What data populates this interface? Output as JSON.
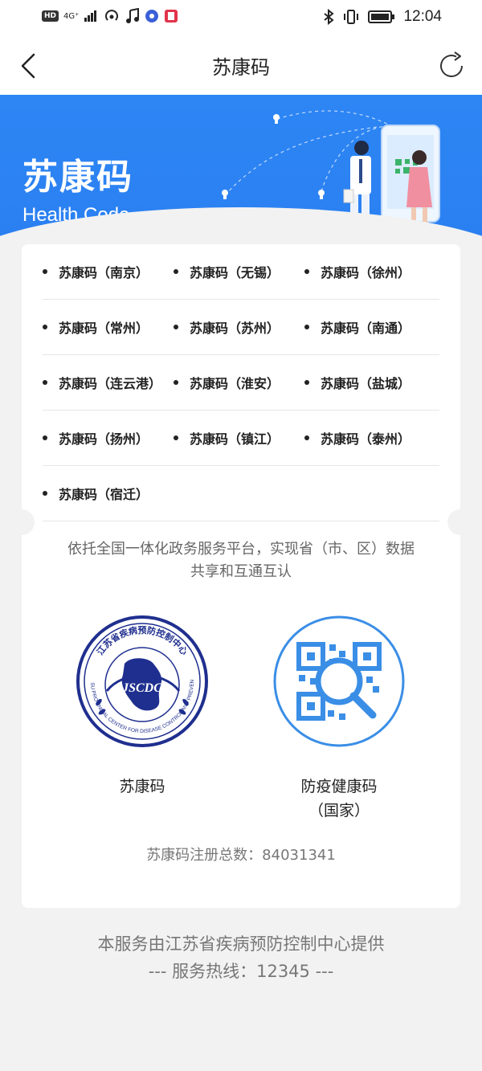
{
  "status_bar": {
    "network_badge": "HD",
    "network_type": "4G⁺",
    "time": "12:04"
  },
  "nav": {
    "title": "苏康码"
  },
  "hero": {
    "title": "苏康码",
    "subtitle": "Health Code"
  },
  "regions": [
    [
      "苏康码（南京）",
      "苏康码（无锡）",
      "苏康码（徐州）"
    ],
    [
      "苏康码（常州）",
      "苏康码（苏州）",
      "苏康码（南通）"
    ],
    [
      "苏康码（连云港）",
      "苏康码（淮安）",
      "苏康码（盐城）"
    ],
    [
      "苏康码（扬州）",
      "苏康码（镇江）",
      "苏康码（泰州）"
    ],
    [
      "苏康码（宿迁）"
    ]
  ],
  "intro": {
    "line1": "依托全国一体化政务服务平台，实现省（市、区）数据",
    "line2": "共享和互通互认"
  },
  "apps": {
    "su_kang_ma": {
      "name": "苏康码",
      "logo_text_top": "江苏省疾病预防控制中心",
      "logo_text_bottom": "JIANGSU PROVINCIAL CENTER FOR DISEASE CONTROL AND PREVENTION",
      "logo_mono": "JSCDC"
    },
    "national": {
      "name_line1": "防疫健康码",
      "name_line2": "（国家）"
    }
  },
  "registration": {
    "text": "苏康码注册总数：84031341"
  },
  "footer": {
    "line1": "本服务由江苏省疾病预防控制中心提供",
    "line2": "--- 服务热线：12345 ---"
  },
  "colors": {
    "brand_blue": "#2d86f4",
    "national_blue": "#3a8ee6",
    "logo_navy": "#1f2f8f"
  }
}
